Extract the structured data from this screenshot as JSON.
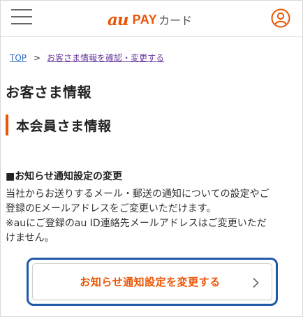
{
  "header": {
    "logo_au": "au",
    "logo_pay": "PAY",
    "logo_card": "カード",
    "menu_icon": "hamburger-menu-icon",
    "account_icon": "user-account-icon"
  },
  "breadcrumb": {
    "top_label": "TOP",
    "separator": ">",
    "current_label": "お客さま情報を確認・変更する"
  },
  "page": {
    "title": "お客さま情報",
    "section_title": "本会員さま情報",
    "sub_heading": "■お知らせ通知設定の変更",
    "body_line1": "当社からお送りするメール・郵送の通知についての設定やご",
    "body_line2": "登録のEメールアドレスをご変更いただけます。",
    "body_line3": "※auにご登録のau ID連絡先メールアドレスはご変更いただ",
    "body_line4": "けません。"
  },
  "action": {
    "label": "お知らせ通知設定を変更する",
    "icon": "chevron-right-icon"
  },
  "colors": {
    "brand": "#eb5505",
    "link": "#2a6cc4",
    "visited_link": "#6a3a9e",
    "focus": "#1e5aa8"
  }
}
